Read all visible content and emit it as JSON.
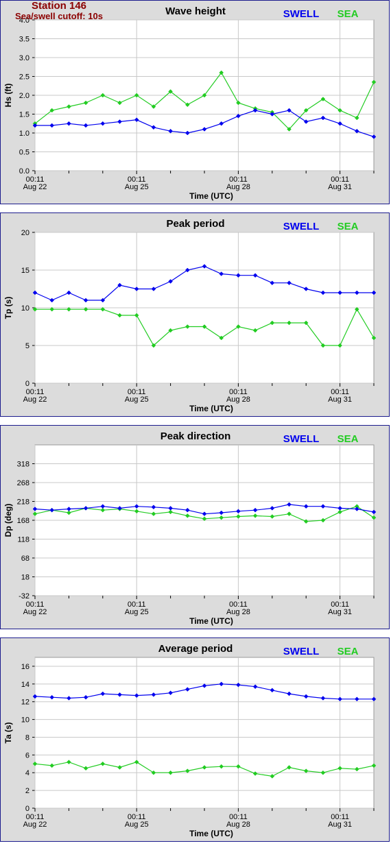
{
  "header": {
    "station": "Station 146",
    "cutoff": "Sea/swell cutoff: 10s"
  },
  "legend": {
    "swell": "SWELL",
    "sea": "SEA"
  },
  "colors": {
    "swell": "#0000ee",
    "sea": "#22cc22",
    "station": "#8b0000",
    "panel_bg": "#dcdcdc",
    "border": "#1a1a8c"
  },
  "x_axis": {
    "label": "Time (UTC)",
    "ticks": [
      {
        "day": 22,
        "line1": "00:11",
        "line2": "Aug 22"
      },
      {
        "day": 25,
        "line1": "00:11",
        "line2": "Aug 25"
      },
      {
        "day": 28,
        "line1": "00:11",
        "line2": "Aug 28"
      },
      {
        "day": 31,
        "line1": "00:11",
        "line2": "Aug 31"
      }
    ],
    "minor_ticks_days": [
      23,
      24,
      26,
      27,
      29,
      30,
      32
    ]
  },
  "chart_data": [
    {
      "type": "line",
      "title": "Wave height",
      "ylabel": "Hs (ft)",
      "xlabel": "Time (UTC)",
      "xlim_days": [
        22.0,
        32.0
      ],
      "ylim": [
        0.0,
        4.0
      ],
      "yticks": [
        "0.0",
        "0.5",
        "1.0",
        "1.5",
        "2.0",
        "2.5",
        "3.0",
        "3.5",
        "4.0"
      ],
      "grid": true,
      "legend": "top-right",
      "series": [
        {
          "name": "SWELL",
          "x": [
            22.0,
            22.5,
            23.0,
            23.5,
            24.0,
            24.5,
            25.0,
            25.5,
            26.0,
            26.5,
            27.0,
            27.5,
            28.0,
            28.5,
            29.0,
            29.5,
            30.0,
            30.5,
            31.0,
            31.5,
            32.0
          ],
          "values": [
            1.2,
            1.2,
            1.25,
            1.2,
            1.25,
            1.3,
            1.35,
            1.15,
            1.05,
            1.0,
            1.1,
            1.25,
            1.45,
            1.6,
            1.5,
            1.6,
            1.3,
            1.4,
            1.25,
            1.05,
            0.9
          ]
        },
        {
          "name": "SEA",
          "x": [
            22.0,
            22.5,
            23.0,
            23.5,
            24.0,
            24.5,
            25.0,
            25.5,
            26.0,
            26.5,
            27.0,
            27.5,
            28.0,
            28.5,
            29.0,
            29.5,
            30.0,
            30.5,
            31.0,
            31.5,
            32.0
          ],
          "values": [
            1.25,
            1.6,
            1.7,
            1.8,
            2.0,
            1.8,
            2.0,
            1.7,
            2.1,
            1.75,
            2.0,
            2.6,
            1.8,
            1.65,
            1.55,
            1.1,
            1.6,
            1.9,
            1.6,
            1.4,
            2.35
          ]
        }
      ]
    },
    {
      "type": "line",
      "title": "Peak period",
      "ylabel": "Tp (s)",
      "xlabel": "Time (UTC)",
      "xlim_days": [
        22.0,
        32.0
      ],
      "ylim": [
        0,
        20
      ],
      "yticks": [
        "0",
        "5",
        "10",
        "15",
        "20"
      ],
      "grid": true,
      "legend": "top-right",
      "series": [
        {
          "name": "SWELL",
          "x": [
            22.0,
            22.5,
            23.0,
            23.5,
            24.0,
            24.5,
            25.0,
            25.5,
            26.0,
            26.5,
            27.0,
            27.5,
            28.0,
            28.5,
            29.0,
            29.5,
            30.0,
            30.5,
            31.0,
            31.5,
            32.0
          ],
          "values": [
            12.0,
            11.0,
            12.0,
            11.0,
            11.0,
            13.0,
            12.5,
            12.5,
            13.5,
            15.0,
            15.5,
            14.5,
            14.3,
            14.3,
            13.3,
            13.3,
            12.5,
            12.0,
            12.0,
            12.0,
            12.0
          ]
        },
        {
          "name": "SEA",
          "x": [
            22.0,
            22.5,
            23.0,
            23.5,
            24.0,
            24.5,
            25.0,
            25.5,
            26.0,
            26.5,
            27.0,
            27.5,
            28.0,
            28.5,
            29.0,
            29.5,
            30.0,
            30.5,
            31.0,
            31.5,
            32.0
          ],
          "values": [
            9.8,
            9.8,
            9.8,
            9.8,
            9.8,
            9.0,
            9.0,
            5.0,
            7.0,
            7.5,
            7.5,
            6.0,
            7.5,
            7.0,
            8.0,
            8.0,
            8.0,
            5.0,
            5.0,
            9.8,
            6.0
          ]
        }
      ]
    },
    {
      "type": "line",
      "title": "Peak direction",
      "ylabel": "Dp (deg)",
      "xlabel": "Time (UTC)",
      "xlim_days": [
        22.0,
        32.0
      ],
      "ylim": [
        -32,
        368
      ],
      "yticks": [
        "-32",
        "18",
        "68",
        "118",
        "168",
        "218",
        "268",
        "318"
      ],
      "grid": true,
      "legend": "top-right",
      "series": [
        {
          "name": "SWELL",
          "x": [
            22.0,
            22.5,
            23.0,
            23.5,
            24.0,
            24.5,
            25.0,
            25.5,
            26.0,
            26.5,
            27.0,
            27.5,
            28.0,
            28.5,
            29.0,
            29.5,
            30.0,
            30.5,
            31.0,
            31.5,
            32.0
          ],
          "values": [
            198,
            195,
            198,
            200,
            205,
            200,
            205,
            203,
            200,
            195,
            185,
            188,
            192,
            195,
            200,
            210,
            205,
            205,
            200,
            198,
            190
          ]
        },
        {
          "name": "SEA",
          "x": [
            22.0,
            22.5,
            23.0,
            23.5,
            24.0,
            24.5,
            25.0,
            25.5,
            26.0,
            26.5,
            27.0,
            27.5,
            28.0,
            28.5,
            29.0,
            29.5,
            30.0,
            30.5,
            31.0,
            31.5,
            32.0
          ],
          "values": [
            185,
            195,
            188,
            200,
            195,
            198,
            192,
            185,
            190,
            180,
            172,
            175,
            178,
            180,
            178,
            185,
            165,
            168,
            190,
            205,
            175
          ]
        }
      ]
    },
    {
      "type": "line",
      "title": "Average period",
      "ylabel": "Ta (s)",
      "xlabel": "Time (UTC)",
      "xlim_days": [
        22.0,
        32.0
      ],
      "ylim": [
        0,
        17
      ],
      "yticks": [
        "0",
        "2",
        "4",
        "6",
        "8",
        "10",
        "12",
        "14",
        "16"
      ],
      "grid": true,
      "legend": "top-right",
      "series": [
        {
          "name": "SWELL",
          "x": [
            22.0,
            22.5,
            23.0,
            23.5,
            24.0,
            24.5,
            25.0,
            25.5,
            26.0,
            26.5,
            27.0,
            27.5,
            28.0,
            28.5,
            29.0,
            29.5,
            30.0,
            30.5,
            31.0,
            31.5,
            32.0
          ],
          "values": [
            12.6,
            12.5,
            12.4,
            12.5,
            12.9,
            12.8,
            12.7,
            12.8,
            13.0,
            13.4,
            13.8,
            14.0,
            13.9,
            13.7,
            13.3,
            12.9,
            12.6,
            12.4,
            12.3,
            12.3,
            12.3
          ]
        },
        {
          "name": "SEA",
          "x": [
            22.0,
            22.5,
            23.0,
            23.5,
            24.0,
            24.5,
            25.0,
            25.5,
            26.0,
            26.5,
            27.0,
            27.5,
            28.0,
            28.5,
            29.0,
            29.5,
            30.0,
            30.5,
            31.0,
            31.5,
            32.0
          ],
          "values": [
            5.0,
            4.8,
            5.2,
            4.5,
            5.0,
            4.6,
            5.2,
            4.0,
            4.0,
            4.2,
            4.6,
            4.7,
            4.7,
            3.9,
            3.6,
            4.6,
            4.2,
            4.0,
            4.5,
            4.4,
            4.8
          ]
        }
      ]
    }
  ]
}
